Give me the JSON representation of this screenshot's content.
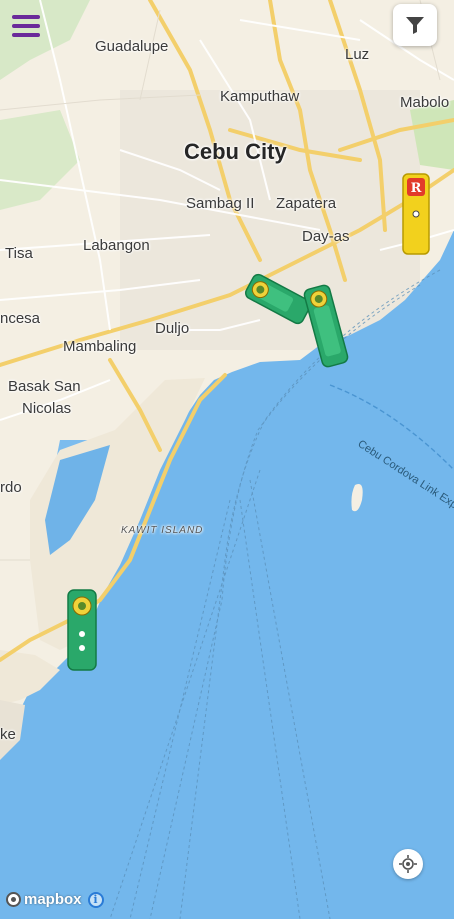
{
  "map": {
    "colors": {
      "land": "#f4efe3",
      "water": "#73b7ec",
      "road_major": "#f6d57a",
      "road_minor": "#ffffff",
      "park": "#c9e3b4",
      "urban": "#e9e4da"
    },
    "labels": {
      "guadalupe": "Guadalupe",
      "luz": "Luz",
      "kamputhaw": "Kamputhaw",
      "mabolo": "Mabolo",
      "cebu_city": "Cebu City",
      "sambag": "Sambag II",
      "zapatera": "Zapatera",
      "dayas": "Day-as",
      "tisa": "Tisa",
      "labangon": "Labangon",
      "incesa": "ncesa",
      "duljo": "Duljo",
      "mambaling": "Mambaling",
      "basak": "Basak San",
      "nicolas": "Nicolas",
      "ordo": "rdo",
      "kawit": "KAWIT ISLAND",
      "ke": "ke",
      "cclex": "Cebu Cordova Link Exp"
    }
  },
  "controls": {
    "menu_icon": "hamburger-menu-icon",
    "filter_icon": "funnel-filter-icon",
    "locate_icon": "crosshair-locate-icon"
  },
  "vehicles": [
    {
      "color": "green",
      "kind": "jeepney"
    },
    {
      "color": "green",
      "kind": "jeepney"
    },
    {
      "color": "green",
      "kind": "jeepney"
    },
    {
      "color": "yellow",
      "kind": "bus"
    }
  ],
  "attribution": {
    "brand": "mapbox",
    "info": "i"
  }
}
